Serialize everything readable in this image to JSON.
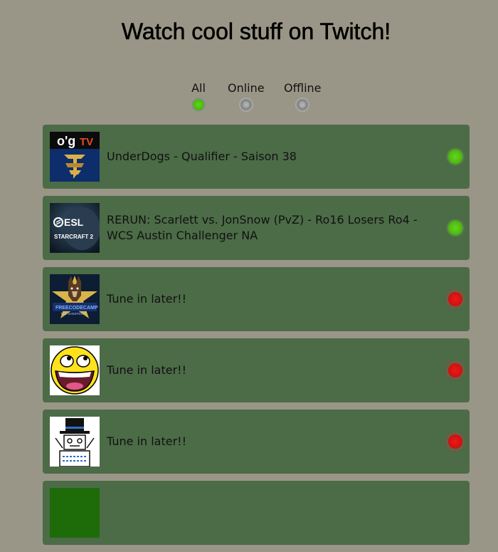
{
  "page": {
    "title": "Watch cool stuff on Twitch!"
  },
  "filters": [
    {
      "label": "All",
      "selected": true
    },
    {
      "label": "Online",
      "selected": false
    },
    {
      "label": "Offline",
      "selected": false
    }
  ],
  "colors": {
    "background": "#9a9687",
    "card": "#4c6b47",
    "online": "#4fb80f",
    "offline": "#d11212"
  },
  "channels": [
    {
      "icon": "ogtv-starcraft-logo",
      "status": "UnderDogs - Qualifier - Saison 38",
      "online": true,
      "logo_text": "o'g",
      "logo_tv": "TV"
    },
    {
      "icon": "esl-starcraft2-logo",
      "status": "RERUN: Scarlett vs. JonSnow (PvZ) - Ro16 Losers Ro4 - WCS Austin Challenger NA",
      "online": true,
      "logo_text": "ESL",
      "logo_sub": "STARCRAFT 2"
    },
    {
      "icon": "sheriff-dog-badge-logo",
      "status": "Tune in later!!",
      "online": false,
      "logo_text": "FREECODECAMP",
      "logo_sub": "THE SHEEPDOG"
    },
    {
      "icon": "awesome-smiley-face",
      "status": "Tune in later!!",
      "online": false
    },
    {
      "icon": "top-hat-robot-drawing",
      "status": "Tune in later!!",
      "online": false
    },
    {
      "icon": "green-square-logo",
      "status": "",
      "online": false
    }
  ]
}
